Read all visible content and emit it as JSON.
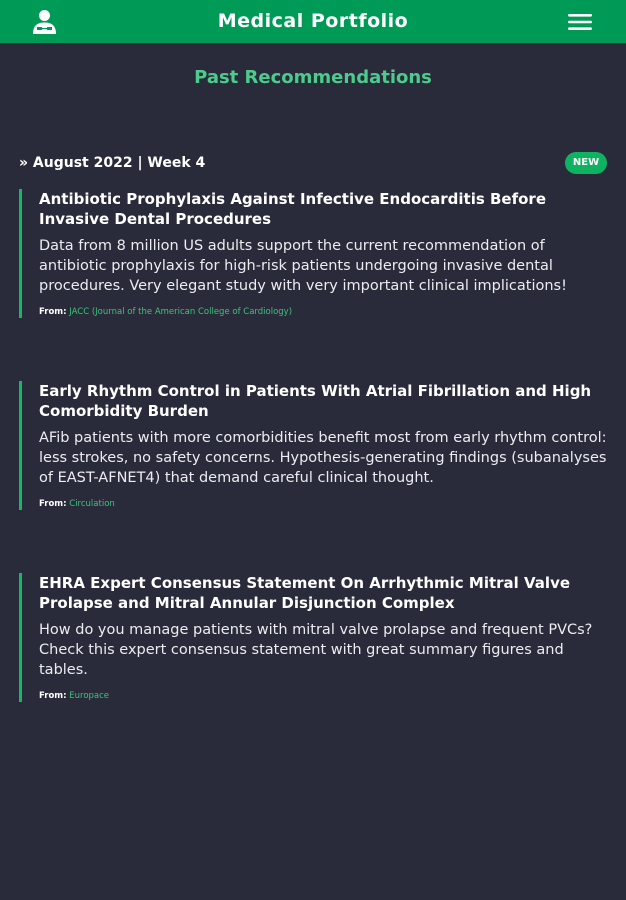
{
  "header": {
    "title": "Medical Portfolio",
    "logo_icon": "doctor-avatar-icon",
    "menu_icon": "hamburger-menu-icon",
    "brand_color": "#009a57"
  },
  "page": {
    "title": "Past Recommendations",
    "accent_color": "#4ccc8c"
  },
  "week": {
    "label": "» August 2022 | Week 4",
    "badge": "NEW"
  },
  "recommendations": [
    {
      "title": "Antibiotic Prophylaxis Against Infective Endocarditis Before Invasive Dental Procedures",
      "summary": "Data from 8 million US adults support the current recommendation of antibiotic prophylaxis for high-risk patients undergoing invasive dental procedures. Very elegant study with very important clinical implications!",
      "from_label": "From:",
      "source": "JACC (Journal of the American College of Cardiology)"
    },
    {
      "title": "Early Rhythm Control in Patients With Atrial Fibrillation and High Comorbidity Burden",
      "summary": "AFib patients with more comorbidities benefit most from early rhythm control: less strokes, no safety concerns. Hypothesis-generating findings (subanalyses of EAST-AFNET4) that demand careful clinical thought.",
      "from_label": "From:",
      "source": "Circulation"
    },
    {
      "title": "EHRA Expert Consensus Statement On Arrhythmic Mitral Valve Prolapse and Mitral Annular Disjunction Complex",
      "summary": "How do you manage patients with mitral valve prolapse and frequent PVCs? Check this expert consensus statement with great summary figures and tables.",
      "from_label": "From:",
      "source": "Europace"
    }
  ]
}
